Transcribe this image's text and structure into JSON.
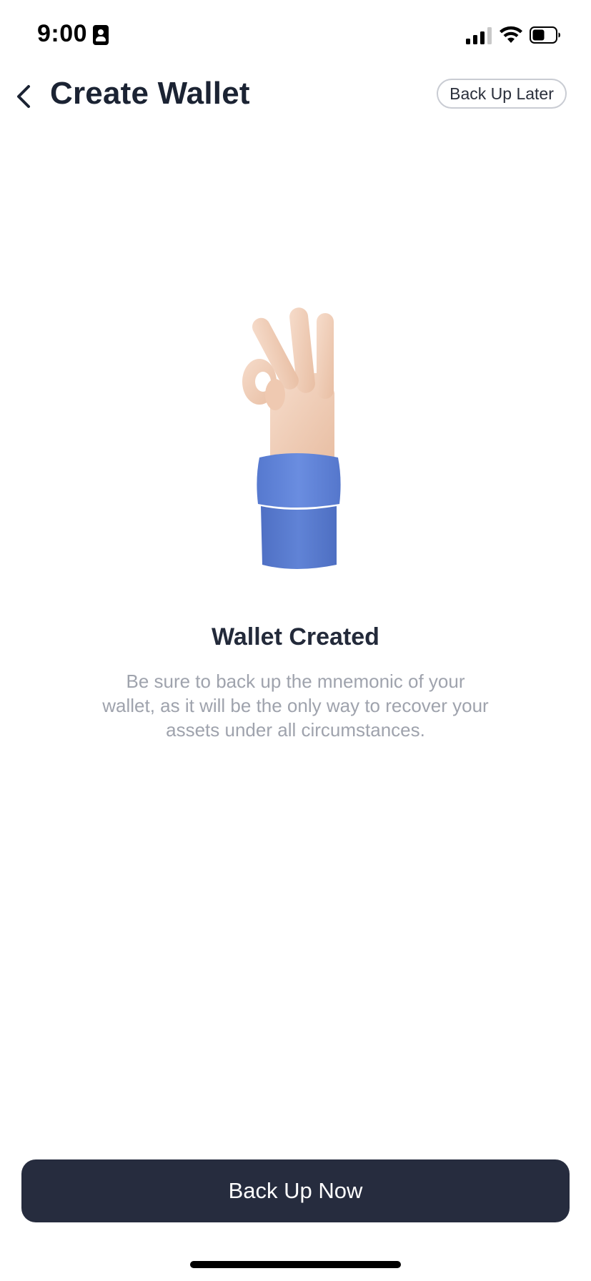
{
  "status_bar": {
    "time": "9:00",
    "icons": [
      "id-card-icon",
      "cellular-signal-icon",
      "wifi-icon",
      "battery-icon"
    ]
  },
  "nav": {
    "title": "Create Wallet",
    "back_icon": "chevron-left-icon",
    "back_up_later_label": "Back Up Later"
  },
  "illustration": {
    "icon": "ok-hand-gesture-illustration",
    "colors": {
      "skin": "#f1cdb5",
      "sleeve": "#5f84d8"
    }
  },
  "main": {
    "title": "Wallet Created",
    "description": "Be sure to back up the mnemonic of your wallet, as it will be the only way to recover your assets under all circumstances."
  },
  "footer": {
    "primary_button_label": "Back Up Now"
  },
  "colors": {
    "primary_button_bg": "#262c3e",
    "title_text": "#1b2333",
    "secondary_text": "#9fa3ad",
    "outline_border": "#c9ccd3"
  }
}
